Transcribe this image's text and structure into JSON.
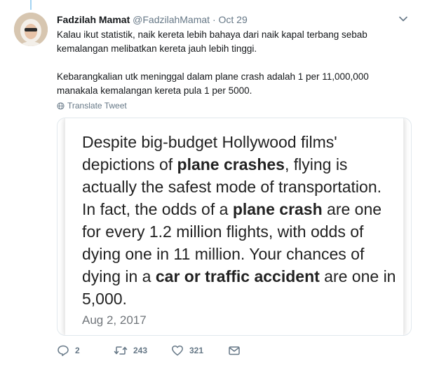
{
  "tweet": {
    "display_name": "Fadzilah Mamat",
    "handle": "@FadzilahMamat",
    "separator": "·",
    "time": "Oct 29",
    "paragraphs": [
      "Kalau ikut statistik, naik kereta lebih bahaya dari naik kapal terbang sebab kemalangan melibatkan kereta jauh lebih tinggi.",
      "Kebarangkalian utk meninggal dalam plane crash adalah 1 per 11,000,000 manakala kemalangan kereta pula 1 per 5000."
    ],
    "translate_label": "Translate Tweet"
  },
  "card": {
    "segments": [
      {
        "text": "Despite big-budget Hollywood films' depictions of ",
        "bold": false
      },
      {
        "text": "plane crashes",
        "bold": true
      },
      {
        "text": ", flying is actually the safest mode of transportation. In fact, the odds of a ",
        "bold": false
      },
      {
        "text": "plane crash",
        "bold": true
      },
      {
        "text": " are one for every 1.2 million flights, with odds of dying one in 11 million. Your chances of dying in a ",
        "bold": false
      },
      {
        "text": "car or traffic accident",
        "bold": true
      },
      {
        "text": " are one in 5,000.",
        "bold": false
      }
    ],
    "date": "Aug 2, 2017"
  },
  "actions": {
    "reply_count": "2",
    "retweet_count": "243",
    "like_count": "321"
  },
  "icons": {
    "avatar": "avatar",
    "caret": "chevron-down-icon",
    "translate": "globe-icon",
    "reply": "reply-icon",
    "retweet": "retweet-icon",
    "like": "heart-icon",
    "message": "envelope-icon"
  },
  "colors": {
    "thread_line": "#a3d4f2",
    "secondary_text": "#657786",
    "primary_text": "#14171a",
    "card_border": "#e1e8ed"
  }
}
